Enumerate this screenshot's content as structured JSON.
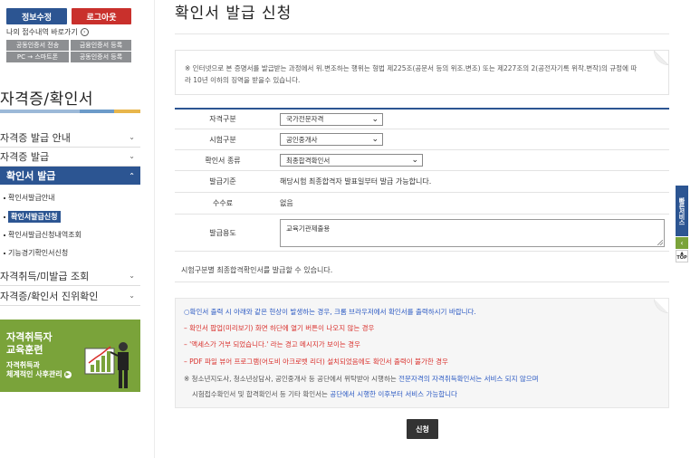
{
  "sidebar": {
    "info_button": "정보수정",
    "logout_button": "로그아웃",
    "recent_link": "나의 접수내역 바로가기",
    "cert_buttons": [
      "공동인증서 전송",
      "금융인증서 등록",
      "PC → 스마트폰",
      "공동인증서 등록"
    ],
    "section_title": "자격증/확인서",
    "menu": [
      {
        "label": "자격증 발급 안내"
      },
      {
        "label": "자격증 발급"
      },
      {
        "label": "확인서 발급"
      }
    ],
    "submenu": [
      {
        "label": "확인서발급안내"
      },
      {
        "label": "확인서발급신청"
      },
      {
        "label": "확인서발급신청내역조회"
      },
      {
        "label": "기능경기확인서신청"
      }
    ],
    "menu_after": [
      {
        "label": "자격취득/미발급 조회"
      },
      {
        "label": "자격증/확인서 진위확인"
      }
    ],
    "promo": {
      "line1": "자격취득자",
      "line2": "교육훈련",
      "line3": "자격취득과",
      "line4": "체계적인 사후관리"
    }
  },
  "main": {
    "title": "확인서 발급 신청",
    "notice": "※ 인터넷으로 본 증명서를 발급받는 과정에서 위.변조하는 행위는 형법 제225조(공문서 등의 위조.변조) 또는 제227조의 2(공전자기록 위작.변작)의 규정에 따라 10년 이하의 징역을 받을수 있습니다.",
    "form": {
      "category_label": "자격구분",
      "category_value": "국가전문자격",
      "exam_label": "시험구분",
      "exam_value": "공인중개사",
      "type_label": "확인서 종류",
      "type_value": "최종합격확인서",
      "criteria_label": "발급기준",
      "criteria_value": "해당시험 최종합격자 발표일부터 발급 가능합니다.",
      "fee_label": "수수료",
      "fee_value": "없음",
      "purpose_label": "발급용도",
      "purpose_value": "교육기관제출용"
    },
    "form_note": "시험구분별 최종합격확인서를 발급할 수 있습니다.",
    "notice2": {
      "l1": "○확인서 출력 시 아래와 같은 현상이 발생하는 경우, 크롬 브라우저에서 확인서를 출력하시기 바랍니다.",
      "l2": "– 확인서 팝업(미리보기) 화면 하단에 열기 버튼이 나오지 않는 경우",
      "l3": "– '액세스가 거부 되었습니다.' 라는 경고 메시지가 보이는 경우",
      "l4": "– PDF 파일 뷰어 프로그램(어도비 아크로벳 리더) 설치되었음에도 확인서 출력이 불가한 경우",
      "l5_a": "※ 청소년지도사, 청소년상담사, 공인중개사 등 공단에서 위탁받아 시행하는 ",
      "l5_b": "전문자격의 자격취득확인서는 서비스 되지 않으며",
      "l6_a": "시험접수확인서 및 합격확인서 등 기타 확인서는 ",
      "l6_b": "공단에서 시행한 이후부터 서비스 가능합니다"
    },
    "submit_label": "신청"
  },
  "floating": {
    "quick_label": "빠른서비스",
    "top_label": "TOP"
  }
}
